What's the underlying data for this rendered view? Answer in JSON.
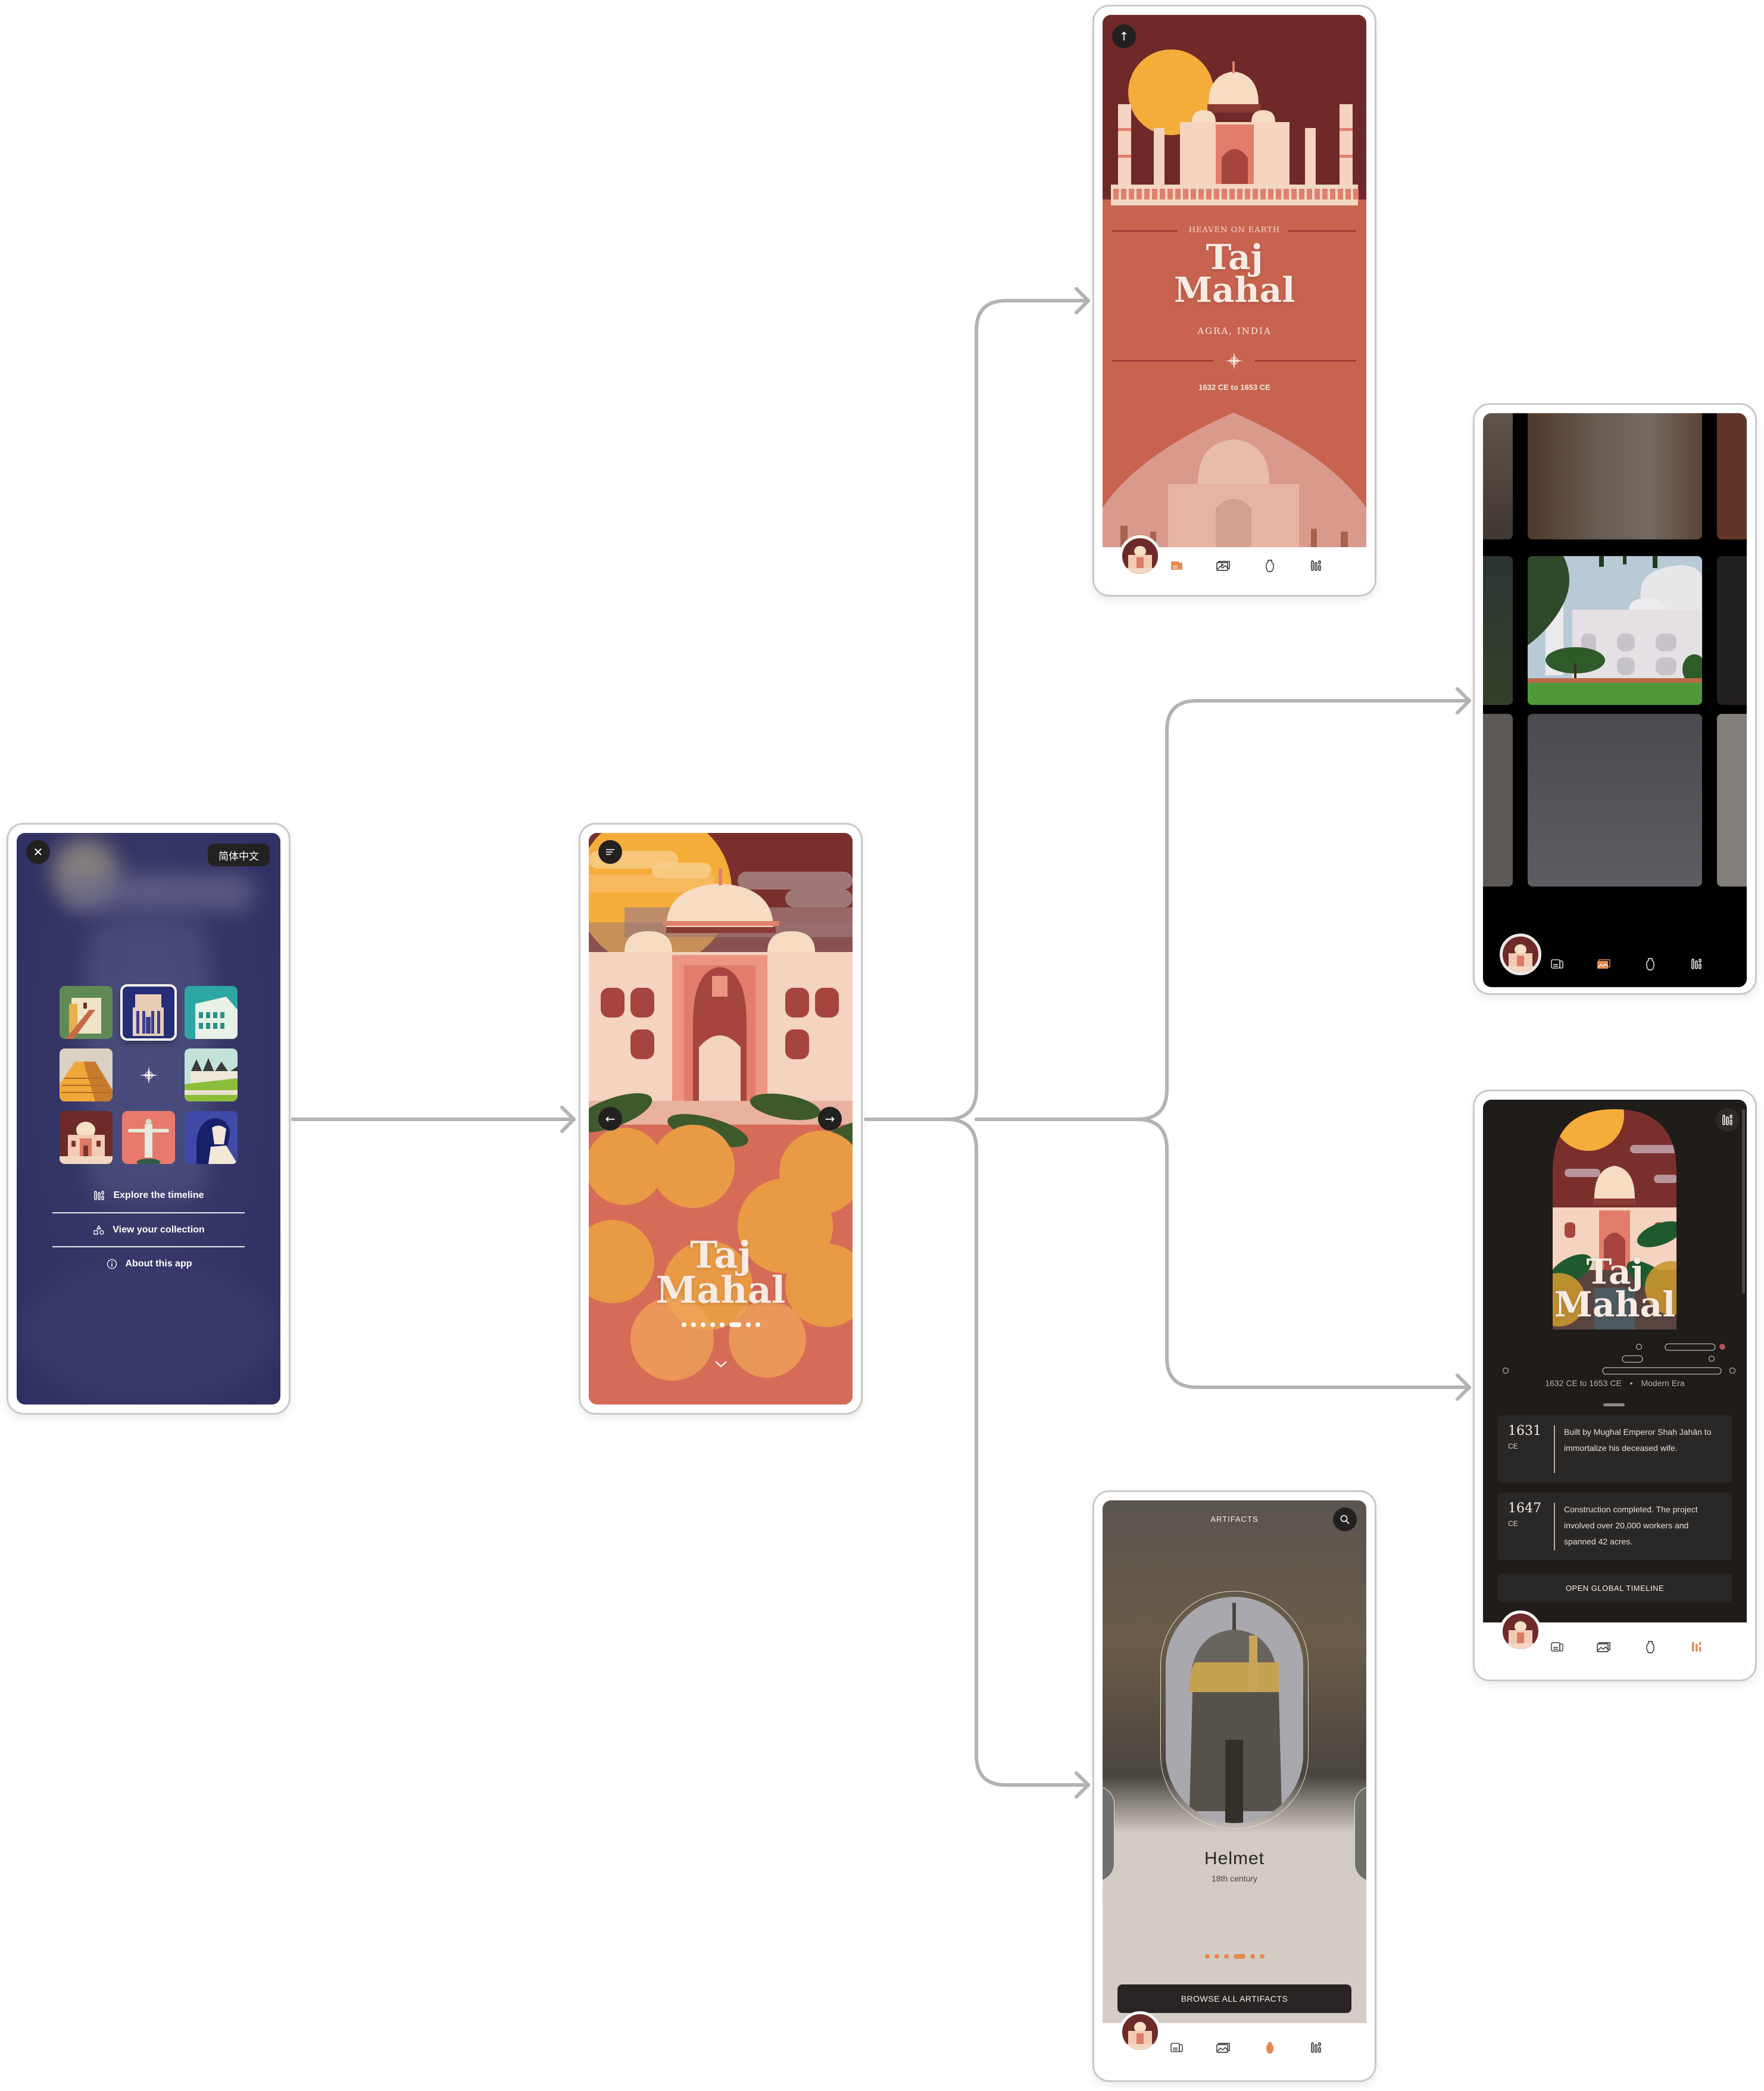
{
  "colors": {
    "connector": "#b3b3b3",
    "accent_orange": "#e38b4f",
    "frame_border": "#c9c9c9",
    "menu_bg": "#32336a",
    "terracotta": "#c8634f",
    "maroon": "#6d2a2a",
    "timeline_bg": "#1f1c1a",
    "artifacts_btn": "#2a2524"
  },
  "menu_screen": {
    "close_icon": "close-icon",
    "language_button": "简体中文",
    "wonders": [
      {
        "name": "Great Wall of China",
        "icon": "great-wall-tile"
      },
      {
        "name": "Petra",
        "icon": "petra-tile",
        "selected": true
      },
      {
        "name": "Colosseum",
        "icon": "colosseum-tile"
      },
      {
        "name": "Chichén Itzá",
        "icon": "chichen-itza-tile"
      },
      {
        "name": "Machu Picchu",
        "icon": "machu-picchu-tile"
      },
      {
        "name": "Taj Mahal",
        "icon": "taj-mahal-tile"
      },
      {
        "name": "Christ the Redeemer",
        "icon": "christ-redeemer-tile"
      },
      {
        "name": "Pyramids of Giza",
        "icon": "pyramids-tile"
      }
    ],
    "menu_items": [
      {
        "label": "Explore the timeline",
        "icon": "timeline-icon"
      },
      {
        "label": "View your collection",
        "icon": "collection-icon"
      },
      {
        "label": "About this app",
        "icon": "info-icon"
      }
    ]
  },
  "intro_screen": {
    "title_line1": "Taj",
    "title_line2": "Mahal",
    "menu_icon": "menu-icon",
    "prev_icon": "arrow-left-icon",
    "next_icon": "arrow-right-icon",
    "down_icon": "chevron-down-icon",
    "pagination": {
      "count": 8,
      "active_index": 5
    }
  },
  "editorial_screen": {
    "back_icon": "arrow-up-icon",
    "eyebrow": "HEAVEN ON EARTH",
    "title_line1": "Taj",
    "title_line2": "Mahal",
    "location": "AGRA, INDIA",
    "date_range": "1632 CE to 1653 CE"
  },
  "nav_tabs": [
    {
      "name": "editorial",
      "icon": "editorial-icon"
    },
    {
      "name": "photo gallery",
      "icon": "gallery-icon"
    },
    {
      "name": "artifacts",
      "icon": "artifact-icon"
    },
    {
      "name": "timeline",
      "icon": "timeline-icon"
    }
  ],
  "gallery_screen": {
    "active_tab": "photo gallery"
  },
  "timeline_screen": {
    "title_line1": "Taj",
    "title_line2": "Mahal",
    "date_range": "1632 CE to 1653 CE",
    "separator": "•",
    "era": "Modern Era",
    "events": [
      {
        "year": "1631",
        "era": "CE",
        "text": "Built by Mughal Emperor Shah Jahān to immortalize his deceased wife."
      },
      {
        "year": "1647",
        "era": "CE",
        "text": "Construction completed. The project involved over 20,000 workers and spanned 42 acres."
      }
    ],
    "open_global_timeline": "OPEN GLOBAL TIMELINE",
    "active_tab": "timeline"
  },
  "artifacts_screen": {
    "header": "ARTIFACTS",
    "search_icon": "search-icon",
    "artifact_name": "Helmet",
    "artifact_date": "18th century",
    "pagination": {
      "count": 6,
      "active_index": 3
    },
    "browse_button": "BROWSE ALL ARTIFACTS",
    "active_tab": "artifacts"
  }
}
